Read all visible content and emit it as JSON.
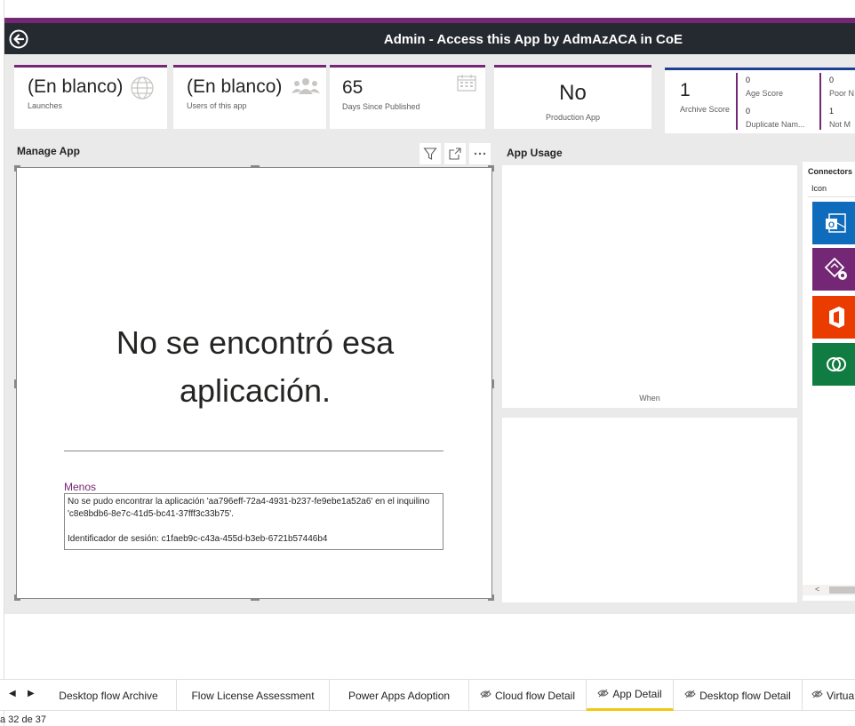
{
  "header": {
    "title": "Admin - Access this App by AdmAzACA in CoE"
  },
  "cards": {
    "launches": {
      "value": "(En blanco)",
      "label": "Launches",
      "icon": "globe-icon"
    },
    "users": {
      "value": "(En blanco)",
      "label": "Users of this app",
      "icon": "people-icon"
    },
    "days": {
      "value": "65",
      "label": "Days Since Published",
      "icon": "calendar-icon"
    },
    "production": {
      "value": "No",
      "label": "Production App"
    },
    "archive": {
      "value": "1",
      "label": "Archive Score",
      "age_value": "0",
      "age_label": "Age Score",
      "dup_value": "0",
      "dup_label": "Duplicate Nam...",
      "poor_value": "0",
      "poor_label": "Poor N",
      "notm_value": "1",
      "notm_label": "Not M"
    }
  },
  "manage_app": {
    "title": "Manage App",
    "error_title_line1": "No se encontró esa",
    "error_title_line2": "aplicación.",
    "menos": "Menos",
    "details": "No se pudo encontrar la aplicación 'aa796eff-72a4-4931-b237-fe9ebe1a52a6' en el inquilino 'c8e8bdb6-8e7c-41d5-bc41-37fff3c33b75'.\n\nIdentificador de sesión: c1faeb9c-c43a-455d-b3eb-6721b57446b4"
  },
  "app_usage": {
    "title": "App Usage",
    "axis_label": "When"
  },
  "connectors": {
    "title": "Connectors",
    "column": "Icon",
    "scroll_left": "<",
    "items": [
      {
        "name": "outlook-icon",
        "color": "#0f6cbd"
      },
      {
        "name": "power-apps-icon",
        "color": "#742774"
      },
      {
        "name": "office-icon",
        "color": "#eb3c00"
      },
      {
        "name": "dataverse-icon",
        "color": "#107c41"
      }
    ]
  },
  "tabs": {
    "prev": "◀",
    "next": "▶",
    "items": [
      {
        "label": "Desktop flow Archive",
        "hidden": false
      },
      {
        "label": "Flow License Assessment",
        "hidden": false
      },
      {
        "label": "Power Apps Adoption",
        "hidden": false
      },
      {
        "label": "Cloud flow Detail",
        "hidden": true
      },
      {
        "label": "App Detail",
        "hidden": true,
        "active": true
      },
      {
        "label": "Desktop flow Detail",
        "hidden": true
      },
      {
        "label": "Virtua",
        "hidden": true
      }
    ]
  },
  "status": {
    "page": "a 32 de 37"
  },
  "colors": {
    "accent": "#742774",
    "title_bar": "#252a30",
    "active_tab": "#f2c811"
  }
}
